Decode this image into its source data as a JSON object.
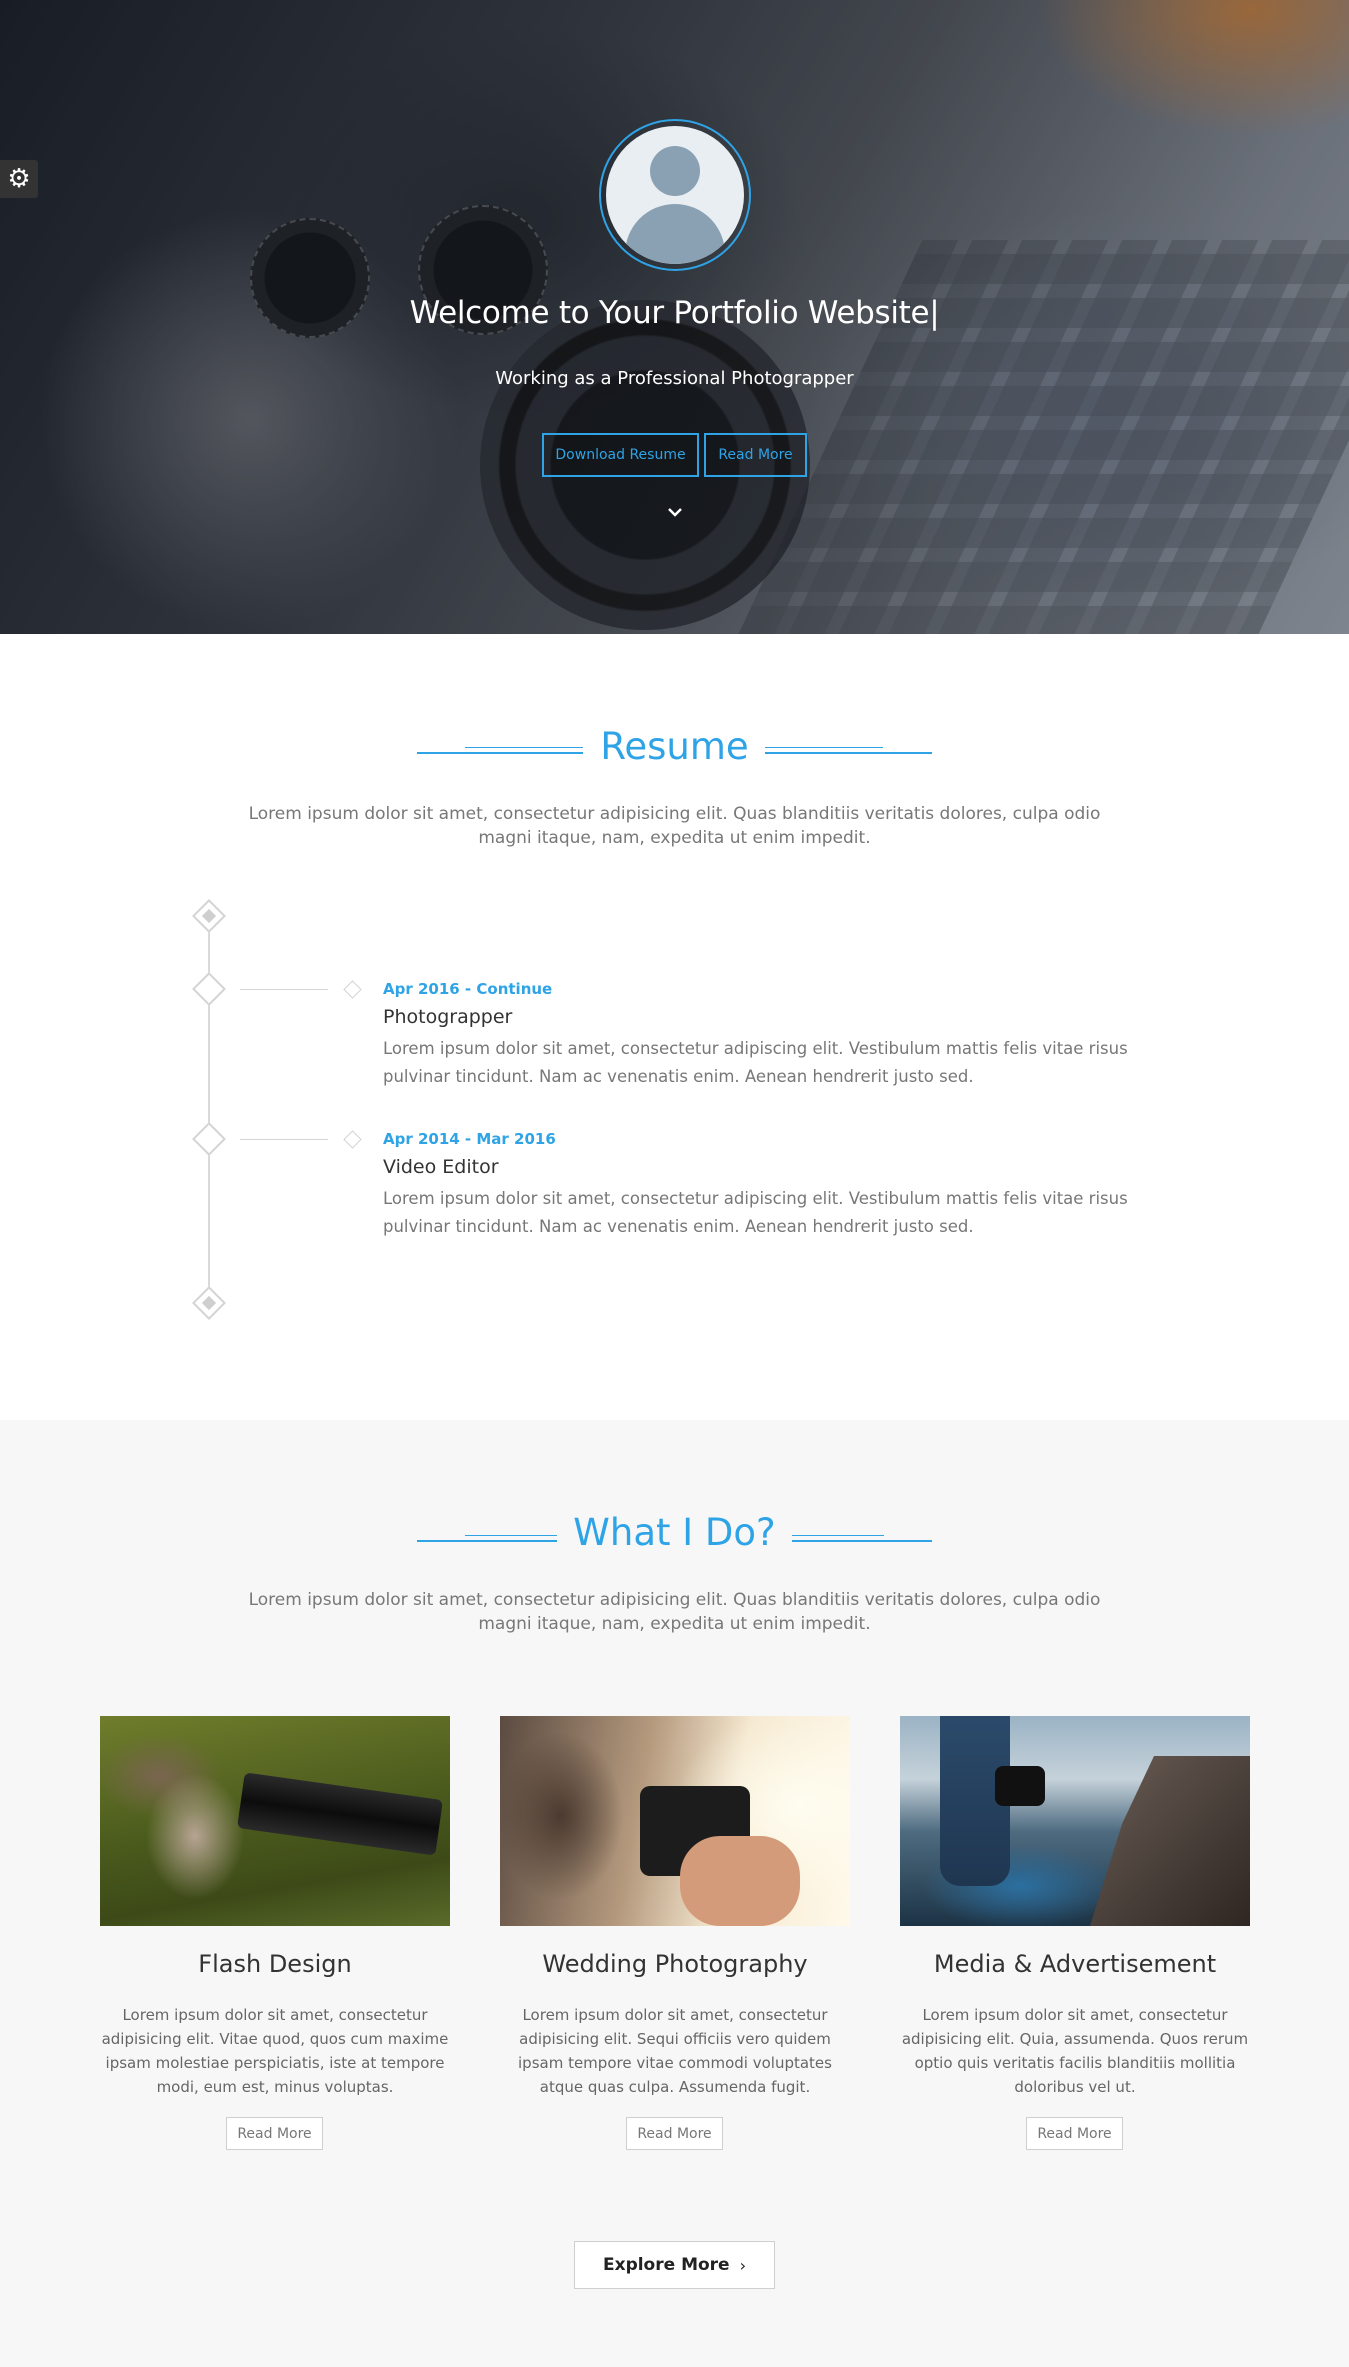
{
  "hero": {
    "title": "Welcome to Your Portfolio Website|",
    "subtitle": "Working as a Professional Photograpper",
    "download_label": "Download Resume",
    "readmore_label": "Read More",
    "settings_icon": "gear-icon",
    "scroll_icon": "chevron-down-icon",
    "accent_color": "#2ea3e6"
  },
  "resume": {
    "title": "Resume",
    "description": "Lorem ipsum dolor sit amet, consectetur adipisicing elit. Quas blanditiis veritatis dolores, culpa odio magni itaque, nam, expedita ut enim impedit.",
    "items": [
      {
        "date": "Apr 2016 - Continue",
        "role": "Photograpper",
        "text": "Lorem ipsum dolor sit amet, consectetur adipiscing elit. Vestibulum mattis felis vitae risus pulvinar tincidunt. Nam ac venenatis enim. Aenean hendrerit justo sed."
      },
      {
        "date": "Apr 2014 - Mar 2016",
        "role": "Video Editor",
        "text": "Lorem ipsum dolor sit amet, consectetur adipiscing elit. Vestibulum mattis felis vitae risus pulvinar tincidunt. Nam ac venenatis enim. Aenean hendrerit justo sed."
      }
    ]
  },
  "whatido": {
    "title": "What I Do?",
    "description": "Lorem ipsum dolor sit amet, consectetur adipisicing elit. Quas blanditiis veritatis dolores, culpa odio magni itaque, nam, expedita ut enim impedit.",
    "cards": [
      {
        "title": "Flash Design",
        "text": "Lorem ipsum dolor sit amet, consectetur adipisicing elit. Vitae quod, quos cum maxime ipsam molestiae perspiciatis, iste at tempore modi, eum est, minus voluptas.",
        "button": "Read More"
      },
      {
        "title": "Wedding Photography",
        "text": "Lorem ipsum dolor sit amet, consectetur adipisicing elit. Sequi officiis vero quidem ipsam tempore vitae commodi voluptates atque quas culpa. Assumenda fugit.",
        "button": "Read More"
      },
      {
        "title": "Media & Advertisement",
        "text": "Lorem ipsum dolor sit amet, consectetur adipisicing elit. Quia, assumenda. Quos rerum optio quis veritatis facilis blanditiis mollitia doloribus vel ut.",
        "button": "Read More"
      }
    ],
    "explore_label": "Explore More",
    "explore_icon": "chevron-right-icon"
  }
}
